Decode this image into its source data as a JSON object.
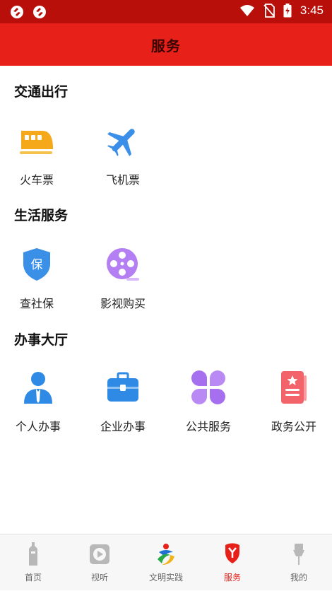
{
  "status_bar": {
    "time": "3:45"
  },
  "header": {
    "title": "服务"
  },
  "sections": [
    {
      "title": "交通出行",
      "items": [
        {
          "label": "火车票",
          "icon": "train-icon"
        },
        {
          "label": "飞机票",
          "icon": "airplane-icon"
        }
      ]
    },
    {
      "title": "生活服务",
      "items": [
        {
          "label": "查社保",
          "icon": "social-insurance-shield-icon"
        },
        {
          "label": "影视购买",
          "icon": "film-reel-icon"
        }
      ]
    },
    {
      "title": "办事大厅",
      "items": [
        {
          "label": "个人办事",
          "icon": "person-icon"
        },
        {
          "label": "企业办事",
          "icon": "briefcase-icon"
        },
        {
          "label": "公共服务",
          "icon": "clover-icon"
        },
        {
          "label": "政务公开",
          "icon": "document-star-icon"
        }
      ]
    }
  ],
  "tabs": [
    {
      "label": "首页",
      "icon": "home-tower-icon"
    },
    {
      "label": "视听",
      "icon": "play-icon"
    },
    {
      "label": "文明实践",
      "icon": "civilization-logo-icon"
    },
    {
      "label": "服务",
      "icon": "service-icon",
      "active": true
    },
    {
      "label": "我的",
      "icon": "profile-icon"
    }
  ],
  "colors": {
    "header": "#e8201a",
    "status_bar": "#b80f0a",
    "active_tab": "#e8201a"
  }
}
